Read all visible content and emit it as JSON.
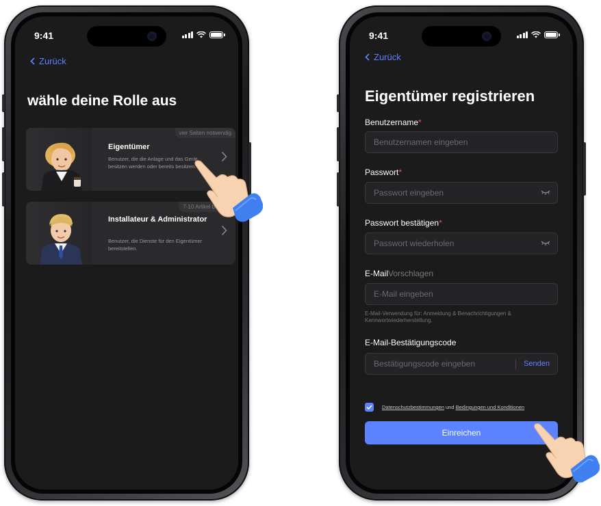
{
  "status": {
    "time": "9:41"
  },
  "screen1": {
    "back_label": "Zurück",
    "title": "wähle deine Rolle aus",
    "roles": [
      {
        "tag": "vier Seiten notwendig",
        "name": "Eigentümer",
        "description": "Benutzer, die die Anlage und das Gerät besitzen werden oder bereits besitzen."
      },
      {
        "tag": "7-10 Artikel benötigt",
        "name": "Installateur & Administrator",
        "description": "Benutzer, die Dienste für den Eigentümer bereitstellen."
      }
    ]
  },
  "screen2": {
    "back_label": "Zurück",
    "title": "Eigentümer registrieren",
    "fields": {
      "username": {
        "label": "Benutzername",
        "required_mark": "*",
        "placeholder": "Benutzernamen eingeben"
      },
      "password": {
        "label": "Passwort",
        "required_mark": "*",
        "placeholder": "Passwort eingeben"
      },
      "confirm": {
        "label": "Passwort bestätigen",
        "required_mark": "*",
        "placeholder": "Passwort wiederholen"
      },
      "email": {
        "label": "E-Mail",
        "suffix": "Vorschlagen",
        "placeholder": "E-Mail eingeben",
        "hint": "E-Mail-Verwendung für: Anmeldung & Benachrichtigungen & Kennwortwiederherstellung."
      },
      "code": {
        "label": "E-Mail-Bestätigungscode",
        "placeholder": "Bestätigungscode eingeben",
        "send_label": "Senden"
      }
    },
    "agreement": {
      "checked": true,
      "privacy": "Datenschutzbestimmungen",
      "and": "und",
      "terms": "Bedingungen und Konditionen"
    },
    "submit_label": "Einreichen"
  },
  "colors": {
    "accent": "#5b82ff",
    "required": "#ff4b4b",
    "screen_bg": "#1b1b1c",
    "card_bg": "#2a2a2c"
  }
}
